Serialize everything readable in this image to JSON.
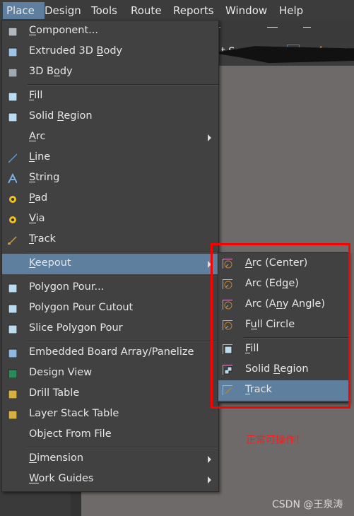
{
  "menubar": [
    {
      "label": "Place",
      "u": 0
    },
    {
      "label": "Design",
      "u": 0
    },
    {
      "label": "Tools",
      "u": 0
    },
    {
      "label": "Route",
      "u": 2
    },
    {
      "label": "Reports",
      "u": 0
    },
    {
      "label": "Window",
      "u": 0
    },
    {
      "label": "Help",
      "u": 0
    }
  ],
  "toolbar": {
    "doc_status": "t Saved)"
  },
  "place_menu": {
    "items": [
      {
        "label": "Component...",
        "u": 0,
        "icon": "component-icon",
        "color": "#b0b8c0"
      },
      {
        "label": "Extruded 3D Body",
        "u": 12,
        "icon": "extruded-3d-body-icon",
        "color": "#9fc4e8"
      },
      {
        "label": "3D Body",
        "u": 4,
        "icon": "3d-body-icon",
        "color": "#a0a8b0"
      },
      {
        "sep": true
      },
      {
        "label": "Fill",
        "u": 0,
        "icon": "fill-icon",
        "color": "#bcdcf0"
      },
      {
        "label": "Solid Region",
        "u": 6,
        "icon": "solid-region-icon",
        "color": "#bcdcf0"
      },
      {
        "label": "Arc",
        "u": 0,
        "icon": "",
        "submenu": true
      },
      {
        "label": "Line",
        "u": 0,
        "icon": "line-icon",
        "color": "#5a9ad8"
      },
      {
        "label": "String",
        "u": 0,
        "icon": "string-icon",
        "color": "#7ab0e0"
      },
      {
        "label": "Pad",
        "u": 0,
        "icon": "pad-icon",
        "color": "#f0c020"
      },
      {
        "label": "Via",
        "u": 0,
        "icon": "via-icon",
        "color": "#f0c020"
      },
      {
        "label": "Track",
        "u": 0,
        "icon": "track-icon",
        "color": "#d0a040"
      },
      {
        "sep": true
      },
      {
        "label": "Keepout",
        "u": 0,
        "icon": "",
        "submenu": true,
        "highlight": true
      },
      {
        "sep": true
      },
      {
        "label": "Polygon Pour...",
        "u": -1,
        "icon": "polygon-pour-icon",
        "color": "#bcdcf0"
      },
      {
        "label": "Polygon Pour Cutout",
        "u": -1,
        "icon": "polygon-pour-cutout-icon",
        "color": "#bcdcf0"
      },
      {
        "label": "Slice Polygon Pour",
        "u": -1,
        "icon": "slice-polygon-pour-icon",
        "color": "#bcdcf0"
      },
      {
        "sep": true
      },
      {
        "label": "Embedded Board Array/Panelize",
        "u": -1,
        "icon": "board-array-icon",
        "color": "#8fb8e0"
      },
      {
        "label": "Design View",
        "u": -1,
        "icon": "design-view-icon",
        "color": "#2a8a5a"
      },
      {
        "label": "Drill Table",
        "u": -1,
        "icon": "drill-table-icon",
        "color": "#d8b040"
      },
      {
        "label": "Layer Stack Table",
        "u": -1,
        "icon": "layer-stack-table-icon",
        "color": "#d8b040"
      },
      {
        "label": "Object From File",
        "u": -1,
        "icon": ""
      },
      {
        "sep": true
      },
      {
        "label": "Dimension",
        "u": 0,
        "icon": "",
        "submenu": true
      },
      {
        "label": "Work Guides",
        "u": 0,
        "icon": "",
        "submenu": true
      }
    ]
  },
  "keepout_menu": {
    "items": [
      {
        "label": "Arc (Center)",
        "u": 0,
        "icon": "arc-center-icon"
      },
      {
        "label": "Arc (Edge)",
        "u": 7,
        "icon": "arc-edge-icon"
      },
      {
        "label": "Arc (Any Angle)",
        "u": 6,
        "icon": "arc-any-angle-icon"
      },
      {
        "label": "Full Circle",
        "u": 1,
        "icon": "full-circle-icon"
      },
      {
        "sep": true
      },
      {
        "label": "Fill",
        "u": 0,
        "icon": "keepout-fill-icon"
      },
      {
        "label": "Solid Region",
        "u": 6,
        "icon": "keepout-solid-region-icon"
      },
      {
        "label": "Track",
        "u": 0,
        "icon": "keepout-track-icon",
        "highlight": true
      }
    ]
  },
  "annotation": "正常可操作！",
  "watermark": "CSDN @王泉涛",
  "colors": {
    "highlight": "#5f7f9f",
    "menu_bg": "#414141",
    "annotation_red": "#ff0000",
    "icon_border": "#e890d0"
  }
}
